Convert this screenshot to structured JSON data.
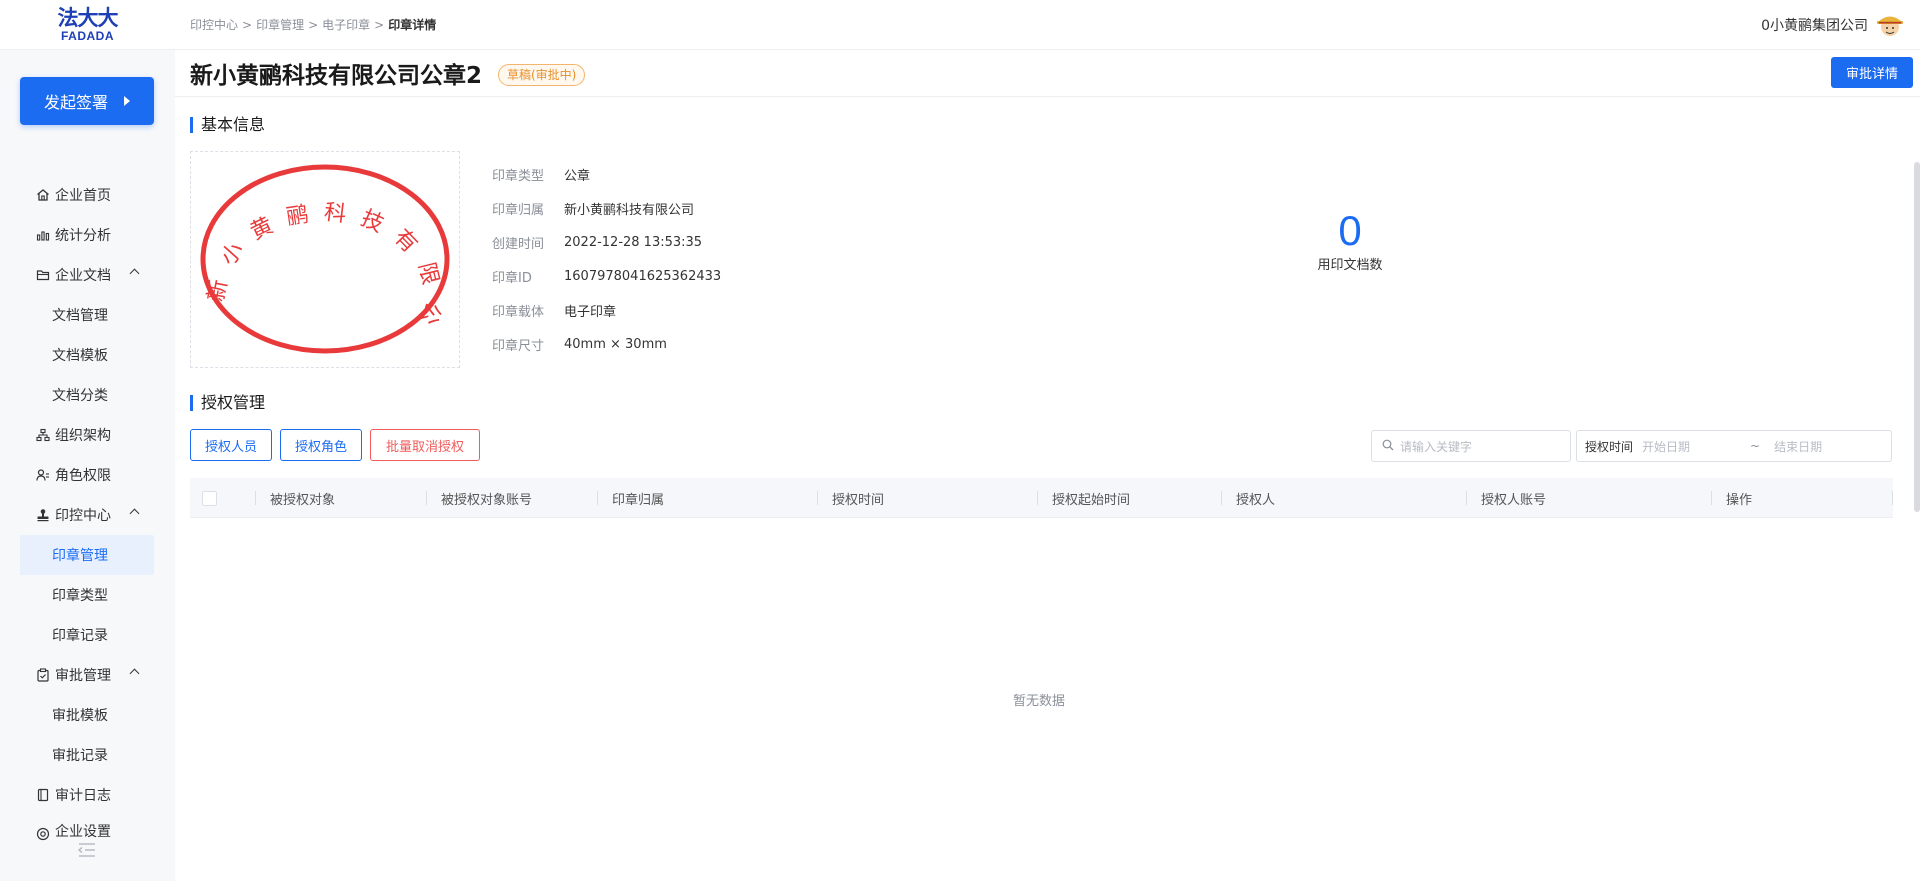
{
  "header": {
    "logo_cn": "法大大",
    "logo_en": "FADADA",
    "breadcrumb": [
      "印控中心",
      "印章管理",
      "电子印章",
      "印章详情"
    ],
    "company_name": "0小黄鹂集团公司"
  },
  "sidebar": {
    "start_button": "发起签署",
    "items": [
      {
        "label": "企业首页",
        "icon": "home-icon"
      },
      {
        "label": "统计分析",
        "icon": "chart-icon"
      },
      {
        "label": "企业文档",
        "icon": "folder-icon"
      },
      {
        "label": "文档管理"
      },
      {
        "label": "文档模板"
      },
      {
        "label": "文档分类"
      },
      {
        "label": "组织架构",
        "icon": "org-icon"
      },
      {
        "label": "角色权限",
        "icon": "role-icon"
      },
      {
        "label": "印控中心",
        "icon": "stamp-icon"
      },
      {
        "label": "印章管理"
      },
      {
        "label": "印章类型"
      },
      {
        "label": "印章记录"
      },
      {
        "label": "审批管理",
        "icon": "clipboard-icon"
      },
      {
        "label": "审批模板"
      },
      {
        "label": "审批记录"
      },
      {
        "label": "审计日志",
        "icon": "book-icon"
      },
      {
        "label": "企业设置",
        "icon": "settings-icon"
      }
    ]
  },
  "page": {
    "title": "新小黄鹂科技有限公司公章2",
    "status": "草稿(审批中)",
    "approve_button": "审批详情"
  },
  "basic_info": {
    "section_title": "基本信息",
    "seal_text": "新小黄鹂科技有限公司",
    "rows": [
      {
        "label": "印章类型",
        "value": "公章"
      },
      {
        "label": "印章归属",
        "value": "新小黄鹂科技有限公司"
      },
      {
        "label": "创建时间",
        "value": "2022-12-28 13:53:35"
      },
      {
        "label": "印章ID",
        "value": "1607978041625362433"
      },
      {
        "label": "印章载体",
        "value": "电子印章"
      },
      {
        "label": "印章尺寸",
        "value": "40mm × 30mm"
      }
    ],
    "metric_value": "0",
    "metric_label": "用印文档数"
  },
  "auth": {
    "section_title": "授权管理",
    "btn_people": "授权人员",
    "btn_role": "授权角色",
    "btn_cancel": "批量取消授权",
    "search_placeholder": "请输入关键字",
    "date_label": "授权时间",
    "date_start": "开始日期",
    "date_sep": "~",
    "date_end": "结束日期",
    "columns": [
      "被授权对象",
      "被授权对象账号",
      "印章归属",
      "授权时间",
      "授权起始时间",
      "授权人",
      "授权人账号",
      "操作"
    ],
    "empty_text": "暂无数据"
  },
  "colors": {
    "primary": "#1c6cf2",
    "danger": "#f25c5c",
    "warning": "#e8912c",
    "seal_red": "#e83a3a"
  }
}
